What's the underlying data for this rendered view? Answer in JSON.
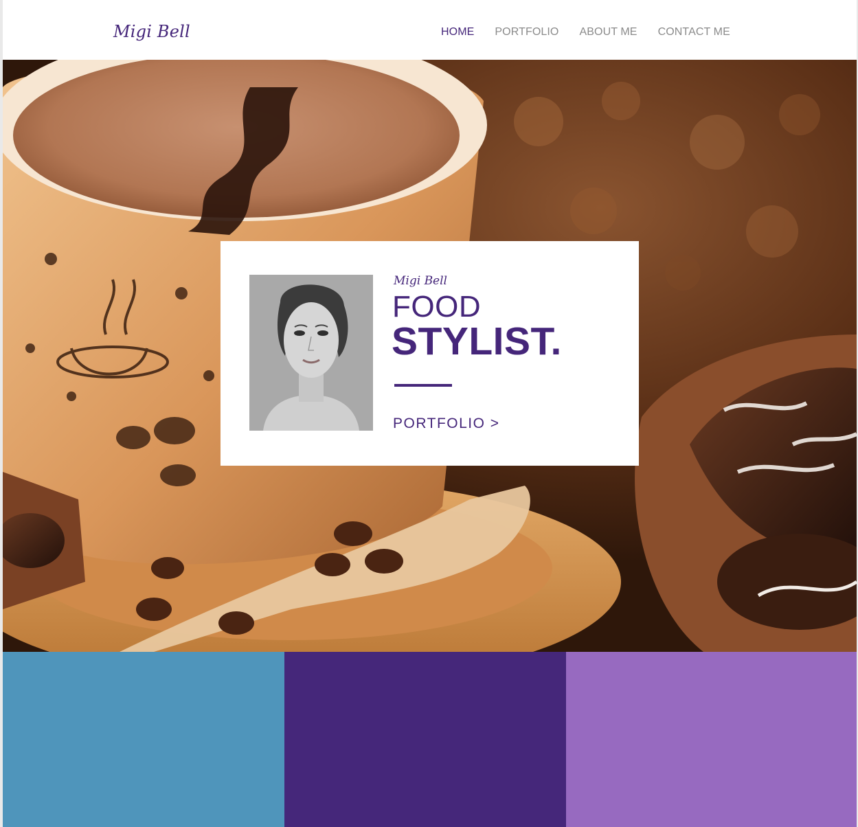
{
  "header": {
    "logo": "Migi Bell",
    "nav": [
      {
        "label": "HOME",
        "active": true
      },
      {
        "label": "PORTFOLIO",
        "active": false
      },
      {
        "label": "ABOUT ME",
        "active": false
      },
      {
        "label": "CONTACT ME",
        "active": false
      }
    ]
  },
  "hero": {
    "card": {
      "name": "Migi Bell",
      "title_line1": "FOOD",
      "title_line2": "STYLIST.",
      "link": "PORTFOLIO >"
    }
  },
  "colors": {
    "accent": "#45267a",
    "block1": "#4f95bb",
    "block2": "#45277a",
    "block3": "#976ac0"
  }
}
